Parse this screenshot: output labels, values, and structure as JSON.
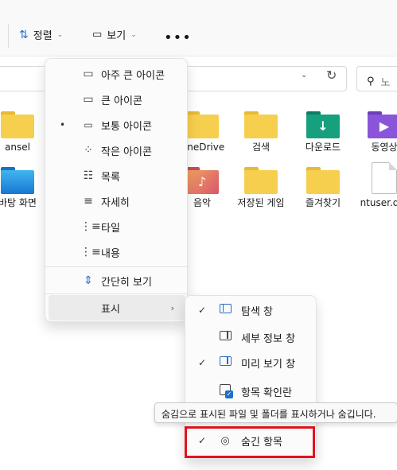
{
  "toolbar": {
    "sort_label": "정렬",
    "view_label": "보기",
    "more": "•••"
  },
  "address": {
    "search_placeholder": "노"
  },
  "files": [
    {
      "name": "ansel",
      "kind": "folder"
    },
    {
      "name": "OneDrive",
      "kind": "folder"
    },
    {
      "name": "검색",
      "kind": "folder"
    },
    {
      "name": "다운로드",
      "kind": "downloads"
    },
    {
      "name": "동영상",
      "kind": "videos"
    },
    {
      "name": "바탕 화면",
      "kind": "desktop"
    },
    {
      "name": "음악",
      "kind": "music"
    },
    {
      "name": "저장된 게임",
      "kind": "folder"
    },
    {
      "name": "즐겨찾기",
      "kind": "folder"
    },
    {
      "name": "ntuser.dat",
      "kind": "file"
    }
  ],
  "view_menu": {
    "items": [
      {
        "label": "아주 큰 아이콘",
        "icon": "monitor-icon"
      },
      {
        "label": "큰 아이콘",
        "icon": "monitor-icon"
      },
      {
        "label": "보통 아이콘",
        "icon": "monitor-icon",
        "selected_bullet": "•"
      },
      {
        "label": "작은 아이콘",
        "icon": "small-grid-icon"
      },
      {
        "label": "목록",
        "icon": "list-icon"
      },
      {
        "label": "자세히",
        "icon": "details-icon"
      },
      {
        "label": "타일",
        "icon": "tiles-icon"
      },
      {
        "label": "내용",
        "icon": "content-icon"
      }
    ],
    "compact": {
      "label": "간단히 보기",
      "icon": "compact-icon"
    },
    "show": {
      "label": "표시",
      "arrow": "›"
    }
  },
  "show_submenu": {
    "items": [
      {
        "label": "탐색 창",
        "checked": true,
        "icon": "navigation-pane-icon"
      },
      {
        "label": "세부 정보 창",
        "checked": false,
        "icon": "details-pane-icon"
      },
      {
        "label": "미리 보기 창",
        "checked": true,
        "icon": "preview-pane-icon"
      },
      {
        "label": "항목 확인란",
        "checked": false,
        "icon": "item-checkbox-icon"
      },
      {
        "label": "숨긴 항목",
        "checked": true,
        "icon": "eye-icon"
      }
    ],
    "check_mark": "✓"
  },
  "tooltip": {
    "text": "숨김으로 표시된 파일 및 폴더를 표시하거나 숨깁니다."
  },
  "colors": {
    "highlight_box": "#e0141e",
    "accent": "#1d6fd0"
  }
}
